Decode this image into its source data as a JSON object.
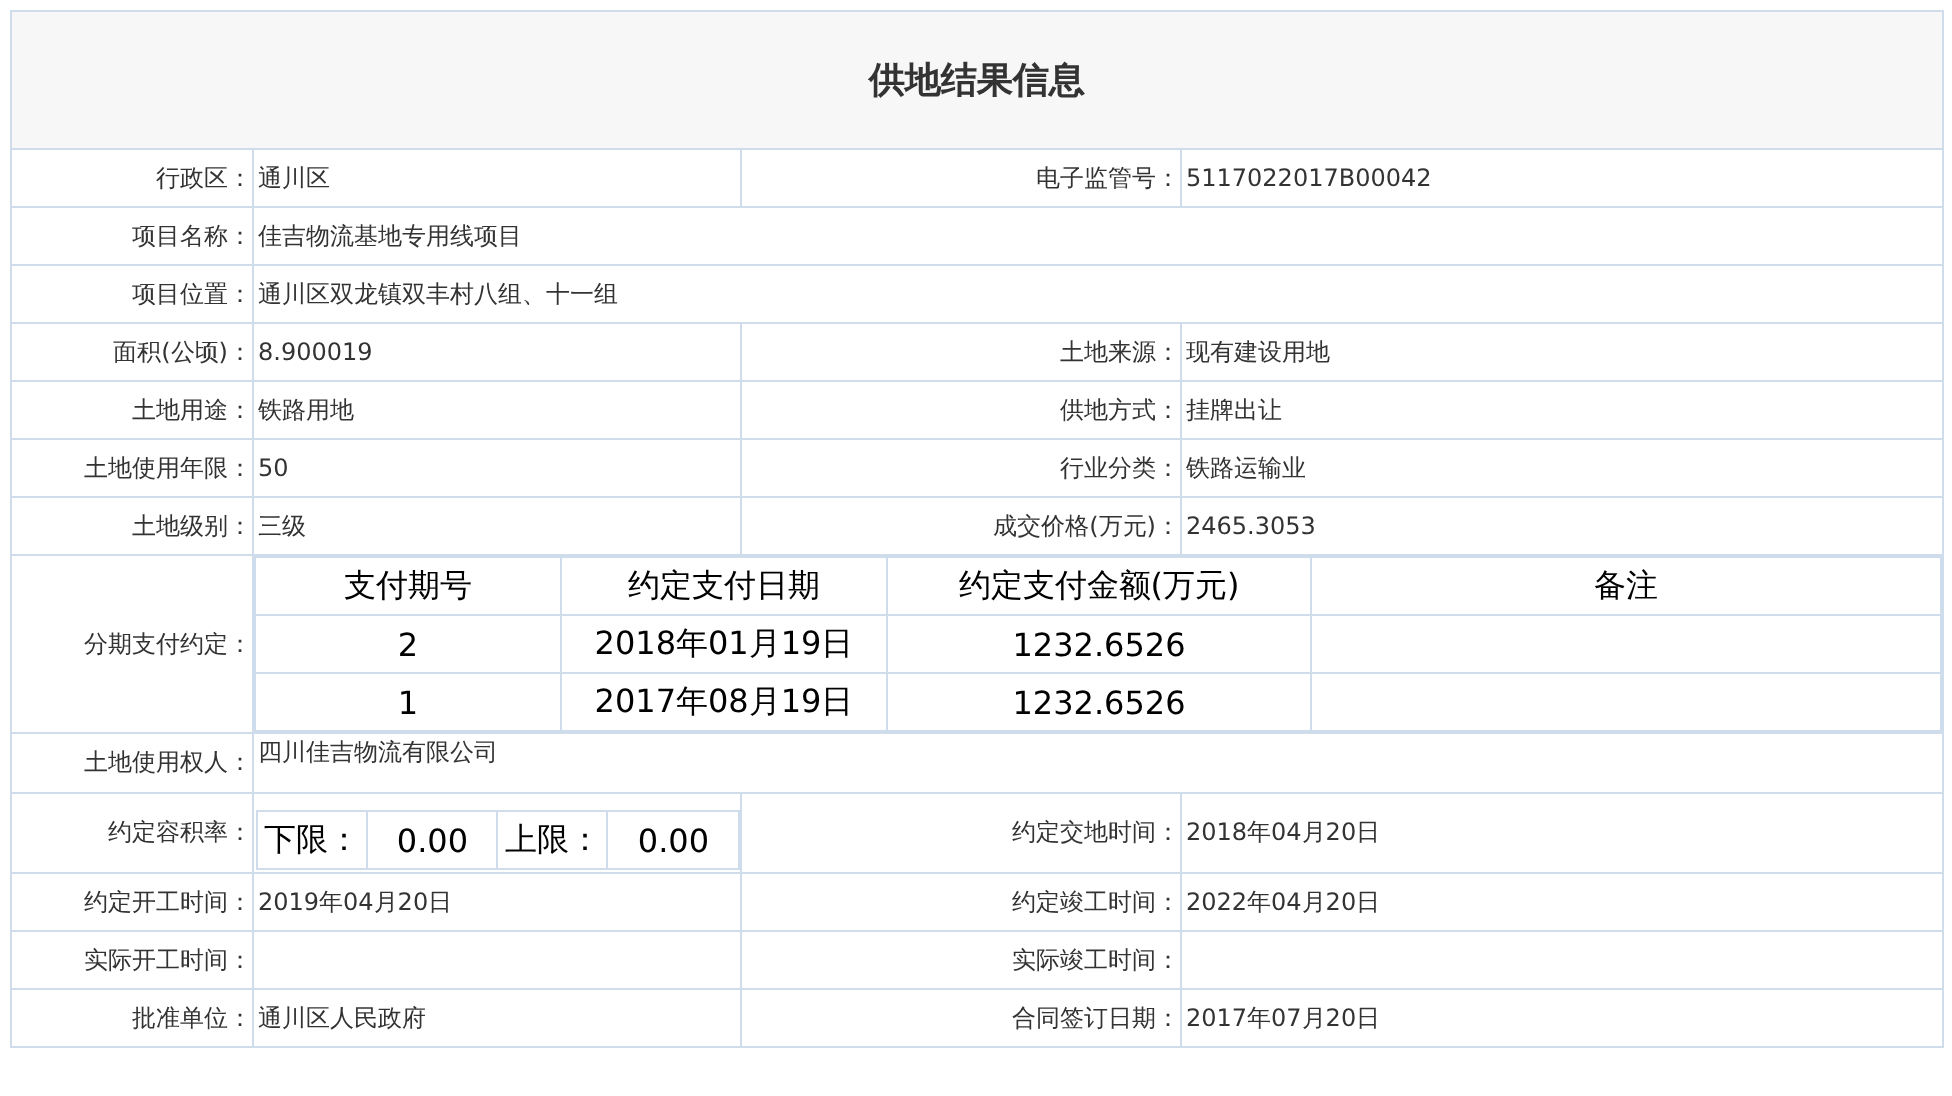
{
  "title": "供地结果信息",
  "rows": [
    {
      "kind": "pair",
      "left": {
        "label": "行政区：",
        "value": "通川区"
      },
      "right": {
        "label": "电子监管号：",
        "value": "5117022017B00042"
      }
    },
    {
      "kind": "wide",
      "label": "项目名称：",
      "value": "佳吉物流基地专用线项目"
    },
    {
      "kind": "wide",
      "label": "项目位置：",
      "value": "通川区双龙镇双丰村八组、十一组"
    },
    {
      "kind": "pair",
      "left": {
        "label": "面积(公顷)：",
        "value": "8.900019"
      },
      "right": {
        "label": "土地来源：",
        "value": "现有建设用地"
      }
    },
    {
      "kind": "pair",
      "left": {
        "label": "土地用途：",
        "value": "铁路用地"
      },
      "right": {
        "label": "供地方式：",
        "value": "挂牌出让"
      }
    },
    {
      "kind": "pair",
      "left": {
        "label": "土地使用年限：",
        "value": "50"
      },
      "right": {
        "label": "行业分类：",
        "value": "铁路运输业"
      }
    },
    {
      "kind": "pair",
      "left": {
        "label": "土地级别：",
        "value": "三级"
      },
      "right": {
        "label": "成交价格(万元)：",
        "value": "2465.3053"
      }
    },
    {
      "kind": "installments",
      "label": "分期支付约定：",
      "columns": [
        "支付期号",
        "约定支付日期",
        "约定支付金额(万元)",
        "备注"
      ],
      "rows": [
        {
          "cells": [
            "2",
            "2018年01月19日",
            "1232.6526"
          ]
        },
        {
          "cells": [
            "1",
            "2017年08月19日",
            "1232.6526"
          ]
        }
      ]
    },
    {
      "kind": "owner",
      "label": "土地使用权人：",
      "value": "四川佳吉物流有限公司"
    },
    {
      "kind": "plot_ratio",
      "label": "约定容积率：",
      "lower_label": "下限：",
      "lower_value": "0.00",
      "upper_label": "上限：",
      "upper_value": "0.00",
      "right": {
        "label": "约定交地时间：",
        "value": "2018年04月20日"
      }
    },
    {
      "kind": "pair",
      "left": {
        "label": "约定开工时间：",
        "value": "2019年04月20日"
      },
      "right": {
        "label": "约定竣工时间：",
        "value": "2022年04月20日"
      }
    },
    {
      "kind": "pair",
      "left": {
        "label": "实际开工时间："
      },
      "right": {
        "label": "实际竣工时间："
      }
    },
    {
      "kind": "pair",
      "left": {
        "label": "批准单位：",
        "value": "通川区人民政府"
      },
      "right": {
        "label": "合同签订日期：",
        "value": "2017年07月20日"
      }
    }
  ]
}
